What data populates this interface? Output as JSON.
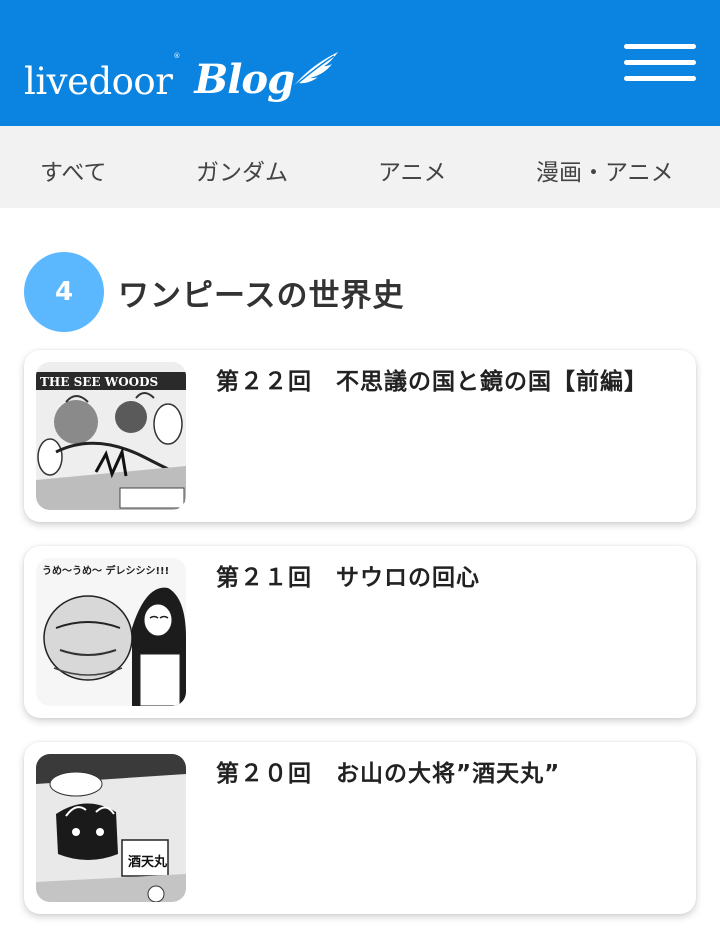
{
  "header": {
    "logo_main": "livedoor",
    "logo_reg": "®",
    "logo_blog": "Blog",
    "brand_color": "#0a84e0"
  },
  "categories": [
    "すべて",
    "ガンダム",
    "アニメ",
    "漫画・アニメ"
  ],
  "section": {
    "rank": "4",
    "title": "ワンピースの世界史",
    "accent_color": "#5bb8ff"
  },
  "articles": [
    {
      "title": "第２２回　不思議の国と鏡の国【前編】",
      "thumb_caption": "THE SEE    WOODS"
    },
    {
      "title": "第２１回　サウロの回心",
      "thumb_caption": "うめ〜うめ〜 デレシシシ!!!"
    },
    {
      "title": "第２０回　お山の大将”酒天丸”",
      "thumb_caption": "酒天丸"
    }
  ]
}
